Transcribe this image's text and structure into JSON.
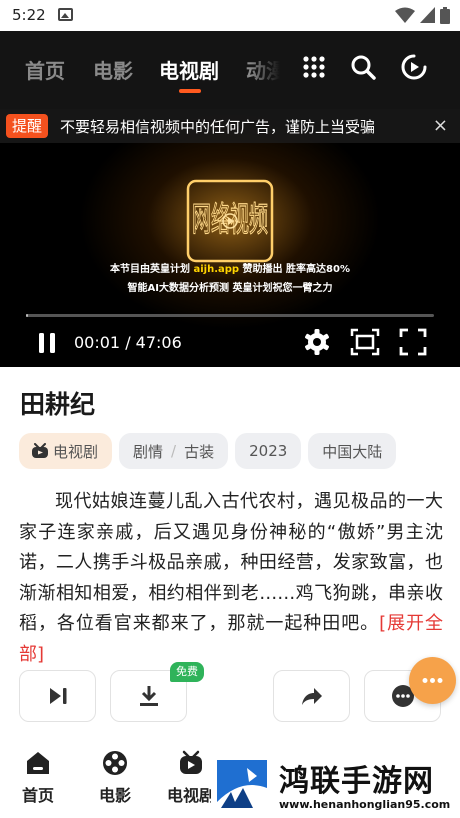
{
  "status_bar": {
    "time": "5:22"
  },
  "top_nav": {
    "tabs": [
      {
        "label": "首页"
      },
      {
        "label": "电影"
      },
      {
        "label": "电视剧"
      },
      {
        "label": "动漫"
      }
    ],
    "active_tab": "电视剧"
  },
  "player": {
    "notice_tag": "提醒",
    "notice_text": "不要轻易相信视频中的任何广告，谨防上当受骗",
    "close_symbol": "×",
    "ad_line1_prefix": "本节目由英皇计划 ",
    "ad_line1_site": "aijh.app",
    "ad_line1_suffix": " 赞助播出 胜率高达80%",
    "ad_line2": "智能AI大数据分析预测 英皇计划祝您一臂之力",
    "logo_text": "网络视频",
    "current_time": "00:01",
    "duration": "47:06",
    "time_display": "00:01 / 47:06",
    "progress": 0.0004
  },
  "detail": {
    "title": "田耕纪",
    "category": "电视剧",
    "genres": [
      "剧情",
      "古装"
    ],
    "year": "2023",
    "region": "中国大陆",
    "description": "现代姑娘连蔓儿乱入古代农村，遇见极品的一大家子连家亲戚，后又遇见身份神秘的“傲娇”男主沈诺，二人携手斗极品亲戚，种田经营，发家致富，也渐渐相知相爱，相约相伴到老……鸡飞狗跳，串亲收稻，各位看官来都来了，那就一起种田吧。",
    "expand_label": "[展开全部]",
    "free_badge": "免费",
    "fab_symbol": "···"
  },
  "bottom_nav": {
    "items": [
      {
        "label": "首页"
      },
      {
        "label": "电影"
      },
      {
        "label": "电视剧"
      }
    ]
  },
  "watermark": {
    "title": "鸿联手游网",
    "url": "www.henanhonglian95.com"
  },
  "colors": {
    "accent": "#ff5a1f",
    "notice_tag": "#f4511e",
    "expand_link": "#e53935",
    "free_badge": "#2fb35a",
    "fab": "#f6a24a",
    "nav_bg": "#141414"
  }
}
